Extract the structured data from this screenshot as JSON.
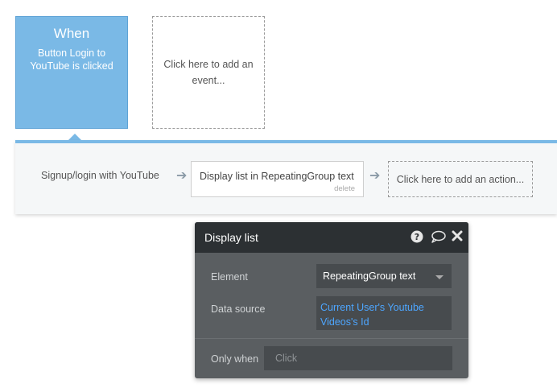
{
  "event": {
    "when_label": "When",
    "description": "Button Login to YouTube is clicked",
    "add_event_label": "Click here to add an event..."
  },
  "workflow": {
    "step_label": "Signup/login with YouTube",
    "action_label": "Display list in RepeatingGroup text",
    "delete_label": "delete",
    "add_action_label": "Click here to add an action..."
  },
  "panel": {
    "title": "Display list",
    "icons": [
      "help-icon",
      "comment-icon",
      "close-icon"
    ],
    "element_label": "Element",
    "element_value": "RepeatingGroup text",
    "data_source_label": "Data source",
    "data_source_value": "Current User's Youtube Videos's Id",
    "only_when_label": "Only when",
    "only_when_placeholder": "Click"
  },
  "colors": {
    "accent": "#7ab9e6",
    "panel_header": "#2c3033",
    "panel_body": "#5a5e61",
    "link": "#4da6ff"
  }
}
